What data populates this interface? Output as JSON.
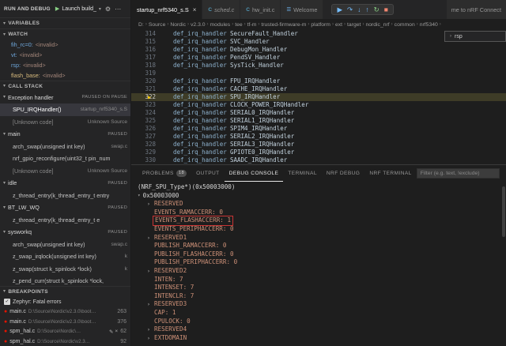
{
  "glyphs": {
    "play": "▶",
    "gear": "⚙",
    "more": "⋯",
    "chev_down": "▾",
    "chev_right": "›",
    "dot": "●",
    "edit": "✎",
    "close": "×",
    "check": "✓",
    "arrow": "▶",
    "colon": ": "
  },
  "run_panel": {
    "title": "RUN AND DEBUG",
    "launch_label": "Launch build_"
  },
  "sidebar": {
    "variables_title": "VARIABLES",
    "watch_title": "WATCH",
    "watch": [
      {
        "name": "fih_rc=0:",
        "value": "<invalid>"
      },
      {
        "name": "vt:",
        "value": "<invalid>"
      },
      {
        "name": "rsp:",
        "value": "<invalid>"
      },
      {
        "name": "flash_base:",
        "value": "<invalid>",
        "changed": true
      }
    ],
    "call_stack_title": "CALL STACK",
    "call_stack": [
      {
        "thread": true,
        "label": "Exception handler",
        "badge": "PAUSED ON PAUSE"
      },
      {
        "label": "SPU_IRQHandler()",
        "right": "startup_nrf5340_s.S",
        "selected": true
      },
      {
        "label": "[Unknown code]",
        "right": "Unknown Source",
        "dim": true
      },
      {
        "thread": true,
        "label": "main",
        "badge": "PAUSED"
      },
      {
        "label": "arch_swap(unsigned int key)",
        "right": "swap.c"
      },
      {
        "label": "nrf_gpio_reconfigure(uint32_t pin_num"
      },
      {
        "label": "[Unknown code]",
        "right": "Unknown Source",
        "dim": true
      },
      {
        "thread": true,
        "label": "idle",
        "badge": "PAUSED"
      },
      {
        "label": "z_thread_entry(k_thread_entry_t entry"
      },
      {
        "thread": true,
        "label": "BT_LW_WQ",
        "badge": "PAUSED"
      },
      {
        "label": "z_thread_entry(k_thread_entry_t e"
      },
      {
        "thread": true,
        "label": "sysworkq",
        "badge": "PAUSED"
      },
      {
        "label": "arch_swap(unsigned int key)",
        "right": "swap.c"
      },
      {
        "label": "z_swap_irqlock(unsigned int key)",
        "right": "k"
      },
      {
        "label": "z_swap(struct k_spinlock *lock)",
        "right": "k"
      },
      {
        "label": "z_pend_curr(struct k_spinlock *lock,"
      }
    ],
    "breakpoints_title": "BREAKPOINTS",
    "breakpoints": [
      {
        "check": true,
        "label": "Zephyr: Fatal errors"
      },
      {
        "bp": true,
        "color": "#e51400",
        "file": "main.c",
        "path": "D:\\Source\\Nordic\\v2.3.0\\boot…",
        "line": "263"
      },
      {
        "bp": true,
        "color": "#e51400",
        "file": "main.c",
        "path": "D:\\Source\\Nordic\\v2.3.0\\boot…",
        "line": "376"
      },
      {
        "bp": true,
        "color": "#e51400",
        "file": "spm_hal.c",
        "path": "D:\\Source\\Nordic\\…",
        "line": "62",
        "actions": true
      },
      {
        "bp": true,
        "color": "#e51400",
        "file": "spm_hal.c",
        "path": "D:\\Source\\Nordic\\v2.3…",
        "line": "92"
      }
    ]
  },
  "tabs": [
    {
      "label": "startup_nrf5340_s.S",
      "active": true,
      "close_visible": true
    },
    {
      "label": "sched.c",
      "icon": "C",
      "icon_color": "#519aba",
      "preview": true
    },
    {
      "label": "hw_init.c",
      "icon": "C",
      "icon_color": "#519aba"
    },
    {
      "label": "Welcome",
      "icon": "☰",
      "icon_color": "#75beff"
    }
  ],
  "right_tab": "me to nRF Connect",
  "debug_toolbar": [
    {
      "name": "continue-button",
      "glyph": "▶",
      "color": "#75beff"
    },
    {
      "name": "step-over-button",
      "glyph": "↷",
      "color": "#75beff"
    },
    {
      "name": "step-into-button",
      "glyph": "↓",
      "color": "#75beff"
    },
    {
      "name": "step-out-button",
      "glyph": "↑",
      "color": "#75beff"
    },
    {
      "name": "restart-button",
      "glyph": "↻",
      "color": "#89d185"
    },
    {
      "name": "stop-button",
      "glyph": "■",
      "color": "#f48771"
    }
  ],
  "breadcrumb": [
    "D:",
    "Source",
    "Nordic",
    "v2.3.0",
    "modules",
    "tee",
    "tf-m",
    "trusted-firmware-m",
    "platform",
    "ext",
    "target",
    "nordic_nrf",
    "common",
    "nrf5340"
  ],
  "peek_label": "rsp",
  "editor_lines": [
    {
      "num": "314",
      "macro": "def_irq_handler",
      "arg": "SecureFault_Handler"
    },
    {
      "num": "315",
      "macro": "def_irq_handler",
      "arg": "SVC_Handler"
    },
    {
      "num": "316",
      "macro": "def_irq_handler",
      "arg": "DebugMon_Handler"
    },
    {
      "num": "317",
      "macro": "def_irq_handler",
      "arg": "PendSV_Handler"
    },
    {
      "num": "318",
      "macro": "def_irq_handler",
      "arg": "SysTick_Handler"
    },
    {
      "num": "319",
      "macro": "",
      "arg": ""
    },
    {
      "num": "320",
      "macro": "def_irq_handler",
      "arg": "FPU_IRQHandler"
    },
    {
      "num": "321",
      "macro": "def_irq_handler",
      "arg": "CACHE_IRQHandler"
    },
    {
      "num": "322",
      "macro": "def_irq_handler",
      "arg": "SPU_IRQHandler",
      "current": true
    },
    {
      "num": "323",
      "macro": "def_irq_handler",
      "arg": "CLOCK_POWER_IRQHandler"
    },
    {
      "num": "324",
      "macro": "def_irq_handler",
      "arg": "SERIAL0_IRQHandler"
    },
    {
      "num": "325",
      "macro": "def_irq_handler",
      "arg": "SERIAL1_IRQHandler"
    },
    {
      "num": "326",
      "macro": "def_irq_handler",
      "arg": "SPIM4_IRQHandler"
    },
    {
      "num": "327",
      "macro": "def_irq_handler",
      "arg": "SERIAL2_IRQHandler"
    },
    {
      "num": "328",
      "macro": "def_irq_handler",
      "arg": "SERIAL3_IRQHandler"
    },
    {
      "num": "329",
      "macro": "def_irq_handler",
      "arg": "GPIOTE0_IRQHandler"
    },
    {
      "num": "330",
      "macro": "def_irq_handler",
      "arg": "SAADC_IRQHandler"
    }
  ],
  "panel": {
    "tabs": [
      {
        "label": "PROBLEMS",
        "badge": "18"
      },
      {
        "label": "OUTPUT"
      },
      {
        "label": "DEBUG CONSOLE",
        "active": true
      },
      {
        "label": "TERMINAL"
      },
      {
        "label": "NRF DEBUG"
      },
      {
        "label": "NRF TERMINAL"
      }
    ],
    "filter_placeholder": "Filter (e.g. text, !exclude)"
  },
  "console": {
    "expr": "(NRF_SPU_Type*)(0x50003000)",
    "root": "0x50003000",
    "items": [
      {
        "label": "RESERVED",
        "group": true
      },
      {
        "label": "EVENTS_RAMACCERR",
        "value": "0"
      },
      {
        "label": "EVENTS_FLASHACCERR",
        "value": "1",
        "boxed": true
      },
      {
        "label": "EVENTS_PERIPHACCERR",
        "value": "0"
      },
      {
        "label": "RESERVED1",
        "group": true
      },
      {
        "label": "PUBLISH_RAMACCERR",
        "value": "0"
      },
      {
        "label": "PUBLISH_FLASHACCERR",
        "value": "0"
      },
      {
        "label": "PUBLISH_PERIPHACCERR",
        "value": "0"
      },
      {
        "label": "RESERVED2",
        "group": true
      },
      {
        "label": "INTEN",
        "value": "7"
      },
      {
        "label": "INTENSET",
        "value": "7"
      },
      {
        "label": "INTENCLR",
        "value": "7"
      },
      {
        "label": "RESERVED3",
        "group": true
      },
      {
        "label": "CAP",
        "value": "1"
      },
      {
        "label": "CPULOCK",
        "value": "0"
      },
      {
        "label": "RESERVED4",
        "group": true
      },
      {
        "label": "EXTDOMAIN",
        "group": true
      }
    ]
  }
}
